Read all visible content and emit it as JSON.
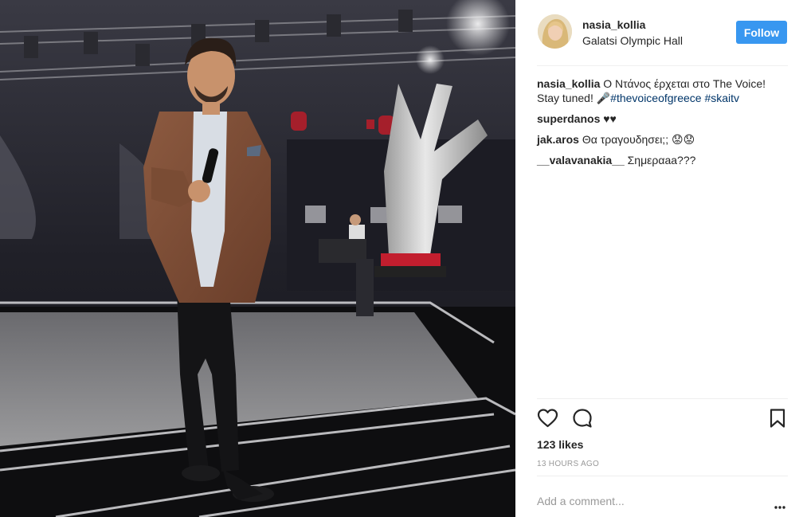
{
  "post": {
    "author": "nasia_kollia",
    "location": "Galatsi Olympic Hall",
    "follow_label": "Follow",
    "photo_alt": "Man in brown blazer holding microphone on The Voice stage"
  },
  "comments": [
    {
      "user": "nasia_kollia",
      "text_before": " Ο Ντάνος έρχεται στο The Voice! Stay tuned! 🎤",
      "tags": [
        "#thevoiceofgreece",
        "#skaitv"
      ]
    },
    {
      "user": "superdanos",
      "text": " ♥♥"
    },
    {
      "user": "jak.aros",
      "text": " Θα τραγουδησει;; 😟😟"
    },
    {
      "user": "__valavanakia__",
      "text": " Σημεραaa???"
    }
  ],
  "stats": {
    "likes": "123 likes",
    "time": "13 HOURS AGO"
  },
  "comment_input": {
    "placeholder": "Add a comment..."
  },
  "icons": {
    "like": "heart-icon",
    "comment": "comment-bubble-icon",
    "save": "bookmark-icon",
    "more": "more-dots-icon"
  }
}
